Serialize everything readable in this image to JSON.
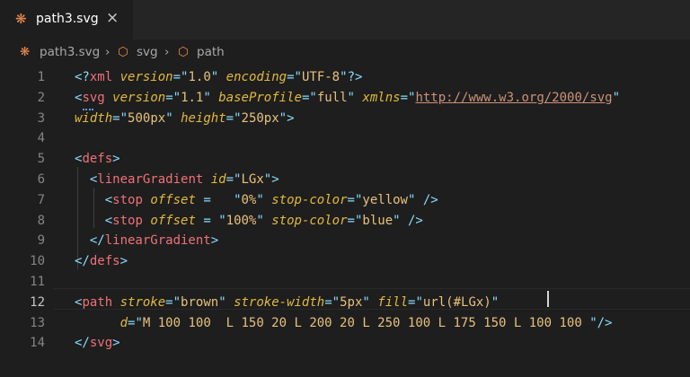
{
  "tab": {
    "icon": "svg-file-icon",
    "name": "path3.svg",
    "close": "×"
  },
  "breadcrumb": {
    "file": "path3.svg",
    "sep": "›",
    "item1": "svg",
    "item2": "path"
  },
  "lines": [
    {
      "n": "1",
      "text": "<?xml version=\"1.0\" encoding=\"UTF-8\"?>"
    },
    {
      "n": "2",
      "text": "<svg version=\"1.1\" baseProfile=\"full\" xmlns=\"http://www.w3.org/2000/svg\""
    },
    {
      "n": "3",
      "text": "width=\"500px\" height=\"250px\">"
    },
    {
      "n": "4",
      "text": ""
    },
    {
      "n": "5",
      "text": "<defs>"
    },
    {
      "n": "6",
      "text": "  <linearGradient id=\"LGx\">"
    },
    {
      "n": "7",
      "text": "    <stop offset =   \"0%\" stop-color=\"yellow\" />"
    },
    {
      "n": "8",
      "text": "    <stop offset = \"100%\" stop-color=\"blue\" />"
    },
    {
      "n": "9",
      "text": "  </linearGradient>"
    },
    {
      "n": "10",
      "text": "</defs>"
    },
    {
      "n": "11",
      "text": ""
    },
    {
      "n": "12",
      "text": "<path stroke=\"brown\" stroke-width=\"5px\" fill=\"url(#LGx)\""
    },
    {
      "n": "13",
      "text": "      d=\"M 100 100  L 150 20 L 200 20 L 250 100 L 175 150 L 100 100 \"/>"
    },
    {
      "n": "14",
      "text": "</svg>"
    }
  ],
  "active_line": "12"
}
